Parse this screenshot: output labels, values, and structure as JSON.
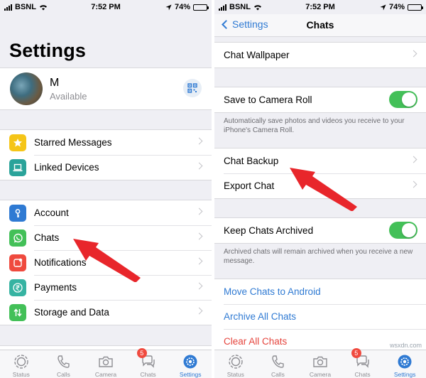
{
  "status": {
    "carrier": "BSNL",
    "time": "7:52 PM",
    "battery": "74%",
    "battery_level": 0.74
  },
  "left": {
    "title": "Settings",
    "profile": {
      "name": "M",
      "status": "Available"
    },
    "group1": [
      {
        "label": "Starred Messages",
        "icon": "star-icon",
        "color": "#f5c518"
      },
      {
        "label": "Linked Devices",
        "icon": "laptop-icon",
        "color": "#2aa39a"
      }
    ],
    "group2": [
      {
        "label": "Account",
        "icon": "key-icon",
        "color": "#2f7ad3"
      },
      {
        "label": "Chats",
        "icon": "whatsapp-icon",
        "color": "#43c058"
      },
      {
        "label": "Notifications",
        "icon": "bell-icon",
        "color": "#ef4a3e"
      },
      {
        "label": "Payments",
        "icon": "rupee-icon",
        "color": "#36b3a2"
      },
      {
        "label": "Storage and Data",
        "icon": "arrows-icon",
        "color": "#43c058"
      }
    ]
  },
  "right": {
    "back_label": "Settings",
    "title": "Chats",
    "chat_wallpaper": "Chat Wallpaper",
    "save_to_camera_roll": "Save to Camera Roll",
    "save_footnote": "Automatically save photos and videos you receive to your iPhone's Camera Roll.",
    "chat_backup": "Chat Backup",
    "export_chat": "Export Chat",
    "keep_archived": "Keep Chats Archived",
    "archived_footnote": "Archived chats will remain archived when you receive a new message.",
    "move_to_android": "Move Chats to Android",
    "archive_all": "Archive All Chats",
    "clear_all": "Clear All Chats"
  },
  "tabs": [
    {
      "label": "Status",
      "icon": "status-icon"
    },
    {
      "label": "Calls",
      "icon": "phone-icon"
    },
    {
      "label": "Camera",
      "icon": "camera-icon"
    },
    {
      "label": "Chats",
      "icon": "chats-icon",
      "badge": "5"
    },
    {
      "label": "Settings",
      "icon": "gear-icon",
      "active": true
    }
  ],
  "colors": {
    "accent": "#2f7ad3",
    "toggle_on": "#43c058",
    "danger": "#e5443d",
    "arrow": "#e8262b"
  },
  "watermark": "wsxdn.com"
}
